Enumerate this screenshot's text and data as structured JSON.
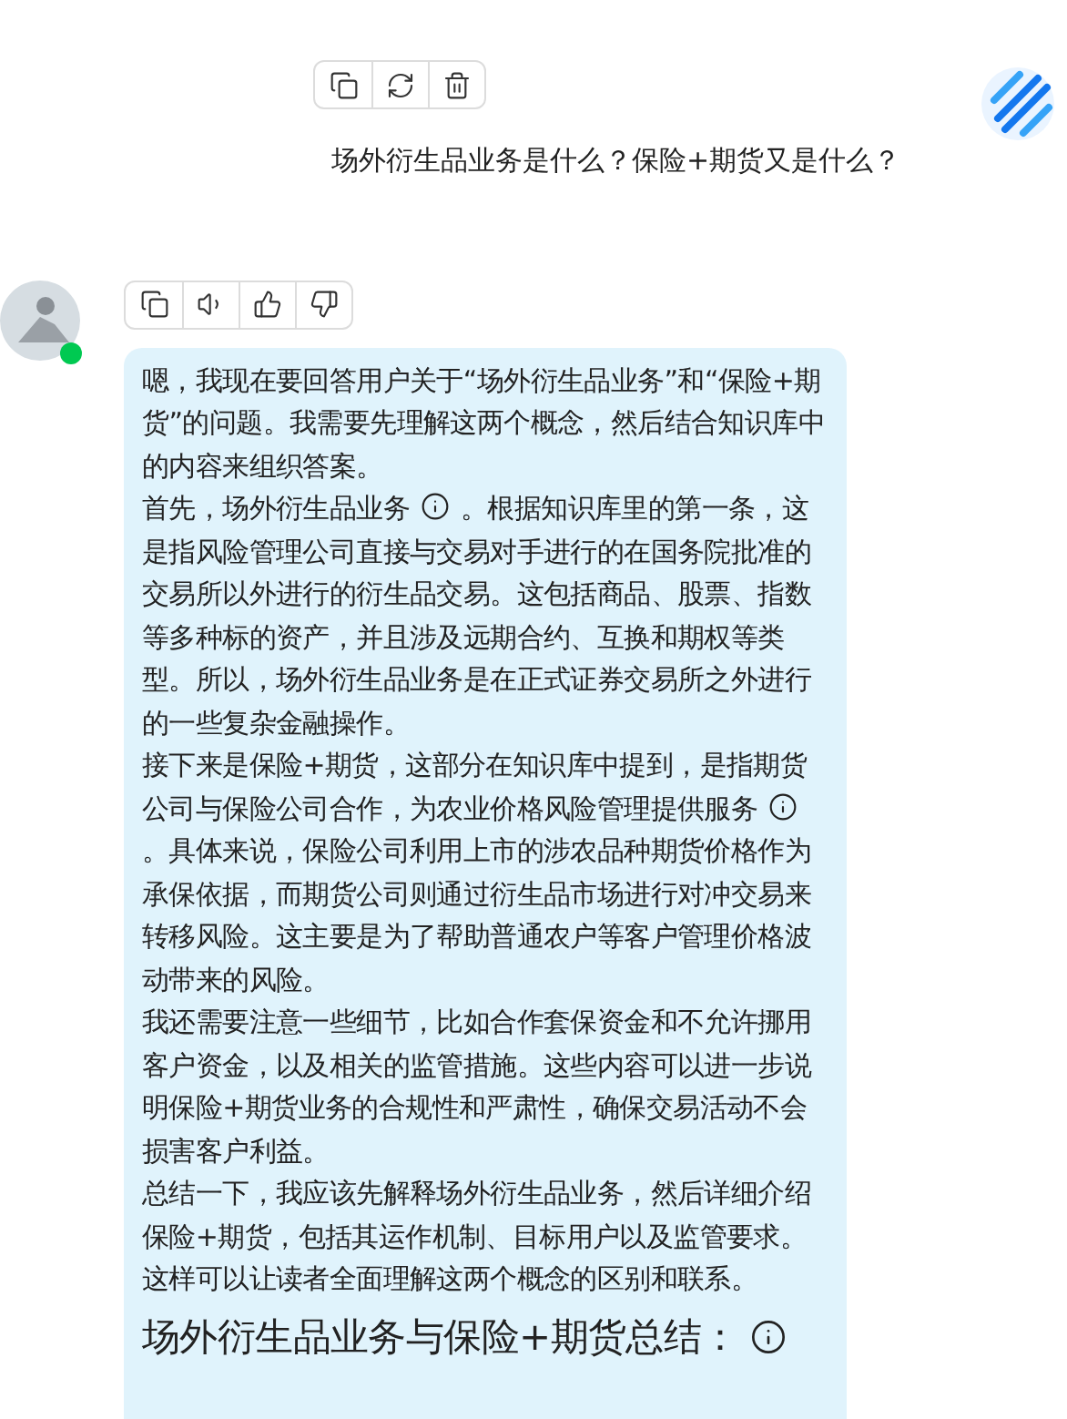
{
  "user_message": {
    "actions": [
      {
        "kind": "copy"
      },
      {
        "kind": "regenerate"
      },
      {
        "kind": "delete"
      }
    ],
    "text": "场外衍生品业务是什么？保险+期货又是什么？"
  },
  "assistant_message": {
    "online": true,
    "actions": [
      {
        "kind": "copy"
      },
      {
        "kind": "speak"
      },
      {
        "kind": "like"
      },
      {
        "kind": "dislike"
      }
    ],
    "paragraphs": [
      {
        "parts": [
          {
            "kind": "text",
            "text": "嗯，我现在要回答用户关于“场外衍生品业务”和“保险+期货”的问题。我需要先理解这两个概念，然后结合知识库中的内容来组织答案。"
          }
        ]
      },
      {
        "parts": [
          {
            "kind": "text",
            "text": "首先，场外衍生品业务"
          },
          {
            "kind": "info"
          },
          {
            "kind": "text",
            "text": "。根据知识库里的第一条，这是指风险管理公司直接与交易对手进行的在国务院批准的交易所以外进行的衍生品交易。这包括商品、股票、指数等多种标的资产，并且涉及远期合约、互换和期权等类型。所以，场外衍生品业务是在正式证券交易所之外进行的一些复杂金融操作。"
          }
        ]
      },
      {
        "parts": [
          {
            "kind": "text",
            "text": "接下来是保险+期货，这部分在知识库中提到，是指期货公司与保险公司合作，为农业价格风险管理提供服务"
          },
          {
            "kind": "info"
          },
          {
            "kind": "text",
            "text": "。具体来说，保险公司利用上市的涉农品种期货价格作为承保依据，而期货公司则通过衍生品市场进行对冲交易来转移风险。这主要是为了帮助普通农户等客户管理价格波动带来的风险。"
          }
        ]
      },
      {
        "parts": [
          {
            "kind": "text",
            "text": "我还需要注意一些细节，比如合作套保资金和不允许挪用客户资金，以及相关的监管措施。这些内容可以进一步说明保险+期货业务的合规性和严肃性，确保交易活动不会损害客户利益。"
          }
        ]
      },
      {
        "parts": [
          {
            "kind": "text",
            "text": "总结一下，我应该先解释场外衍生品业务，然后详细介绍保险+期货，包括其运作机制、目标用户以及监管要求。这样可以让读者全面理解这两个概念的区别和联系。"
          }
        ]
      }
    ],
    "heading": {
      "text": "场外衍生品业务与保险+期货总结：",
      "info": true
    }
  }
}
